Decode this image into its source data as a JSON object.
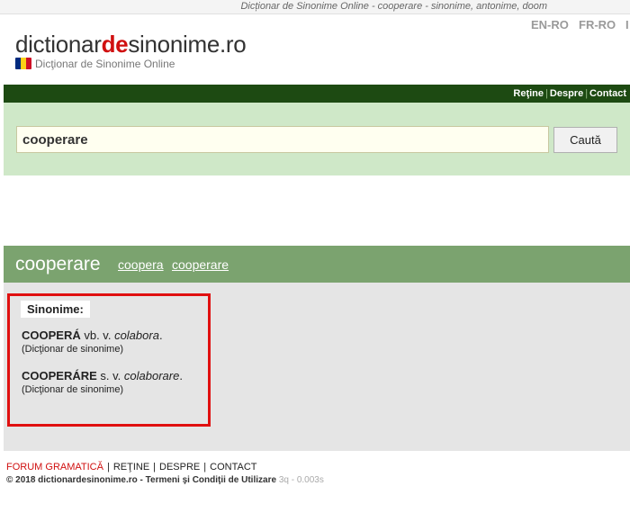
{
  "topbar": {
    "title": "Dicționar de Sinonime Online - cooperare - sinonime, antonime, doom"
  },
  "header": {
    "logo_part1": "dictionar",
    "logo_part2": "de",
    "logo_part3": "sinonime.ro",
    "tagline": "Dicţionar de Sinonime Online",
    "languages": [
      "EN-RO",
      "FR-RO",
      "I"
    ],
    "flag_colors": [
      "#002b7f",
      "#fcd116",
      "#ce1126"
    ]
  },
  "nav": {
    "items": [
      "Reţine",
      "Despre",
      "Contact"
    ]
  },
  "search": {
    "value": "cooperare",
    "button_label": "Caută"
  },
  "result": {
    "word": "cooperare",
    "related_links": [
      "coopera",
      "cooperare"
    ],
    "section_label": "Sinonime:",
    "entries": [
      {
        "headword": "COOPERÁ",
        "grammar": " vb. v. ",
        "synonym": "colabora",
        "end": ".",
        "source": "(Dicţionar de sinonime)"
      },
      {
        "headword": "COOPERÁRE",
        "grammar": " s. v. ",
        "synonym": "colaborare",
        "end": ".",
        "source": "(Dicţionar de sinonime)"
      }
    ]
  },
  "footer": {
    "links": [
      "FORUM GRAMATICĂ",
      "REŢINE",
      "DESPRE",
      "CONTACT"
    ],
    "copyright": "© 2018 dictionardesinonime.ro - ",
    "terms": "Termeni şi Condiţii de Utilizare",
    "timing": "3q - 0.003s"
  },
  "colors": {
    "nav_bg": "#1d4a12",
    "search_bg": "#cfe8c8",
    "result_header_bg": "#7ba36f",
    "result_body_bg": "#e5e5e5",
    "highlight_border": "#e01010",
    "logo_accent": "#d01010"
  }
}
